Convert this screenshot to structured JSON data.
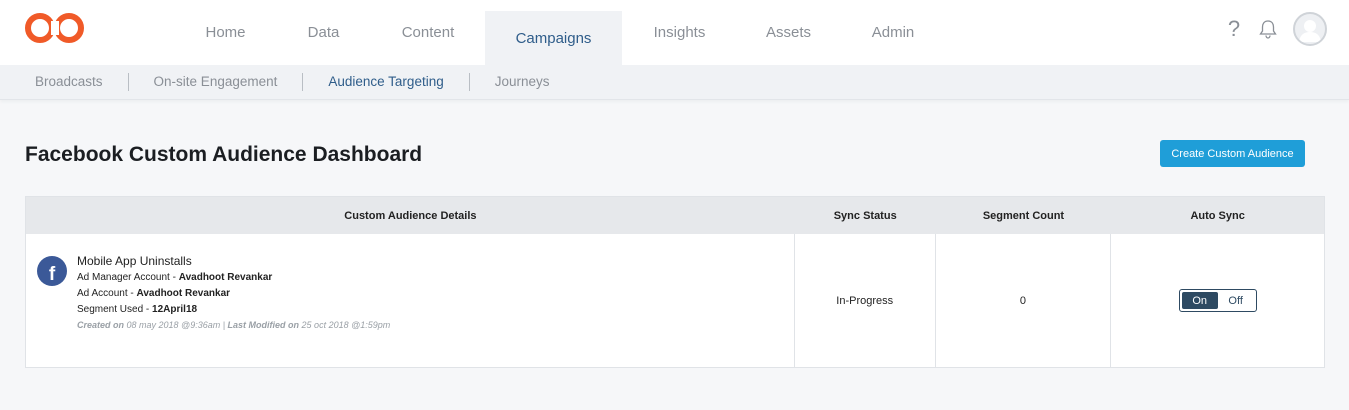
{
  "header": {
    "logo_icon": "infinity-logo-icon",
    "brand_color": "#f05a28",
    "nav_tabs": [
      {
        "label": "Home"
      },
      {
        "label": "Data"
      },
      {
        "label": "Content"
      },
      {
        "label": "Campaigns"
      },
      {
        "label": "Insights"
      },
      {
        "label": "Assets"
      },
      {
        "label": "Admin"
      }
    ],
    "active_tab": "Campaigns",
    "help_icon_glyph": "?",
    "icons": [
      "help-icon",
      "bell-icon",
      "avatar-icon"
    ]
  },
  "subnav": {
    "items": [
      {
        "label": "Broadcasts"
      },
      {
        "label": "On-site Engagement"
      },
      {
        "label": "Audience Targeting"
      },
      {
        "label": "Journeys"
      }
    ],
    "active": "Audience Targeting"
  },
  "page": {
    "title": "Facebook Custom Audience Dashboard",
    "create_button": "Create Custom Audience",
    "accent_color": "#1f9ed8"
  },
  "table": {
    "headers": {
      "details": "Custom Audience Details",
      "sync_status": "Sync Status",
      "segment_count": "Segment Count",
      "auto_sync": "Auto Sync"
    },
    "rows": [
      {
        "icon": "facebook-icon",
        "icon_glyph": "f",
        "name": "Mobile App Uninstalls",
        "ad_manager_label": "Ad Manager Account - ",
        "ad_manager_value": "Avadhoot Revankar",
        "ad_account_label": "Ad Account - ",
        "ad_account_value": "Avadhoot Revankar",
        "segment_label": "Segment Used - ",
        "segment_value": "12April18",
        "created_label": "Created on",
        "created_value": " 08 may 2018 @9:36am | ",
        "modified_label": "Last Modified on",
        "modified_value": " 25 oct 2018 @1:59pm",
        "sync_status": "In-Progress",
        "segment_count": "0",
        "auto_sync_on": "On",
        "auto_sync_off": "Off",
        "auto_sync_state": "On"
      }
    ]
  }
}
